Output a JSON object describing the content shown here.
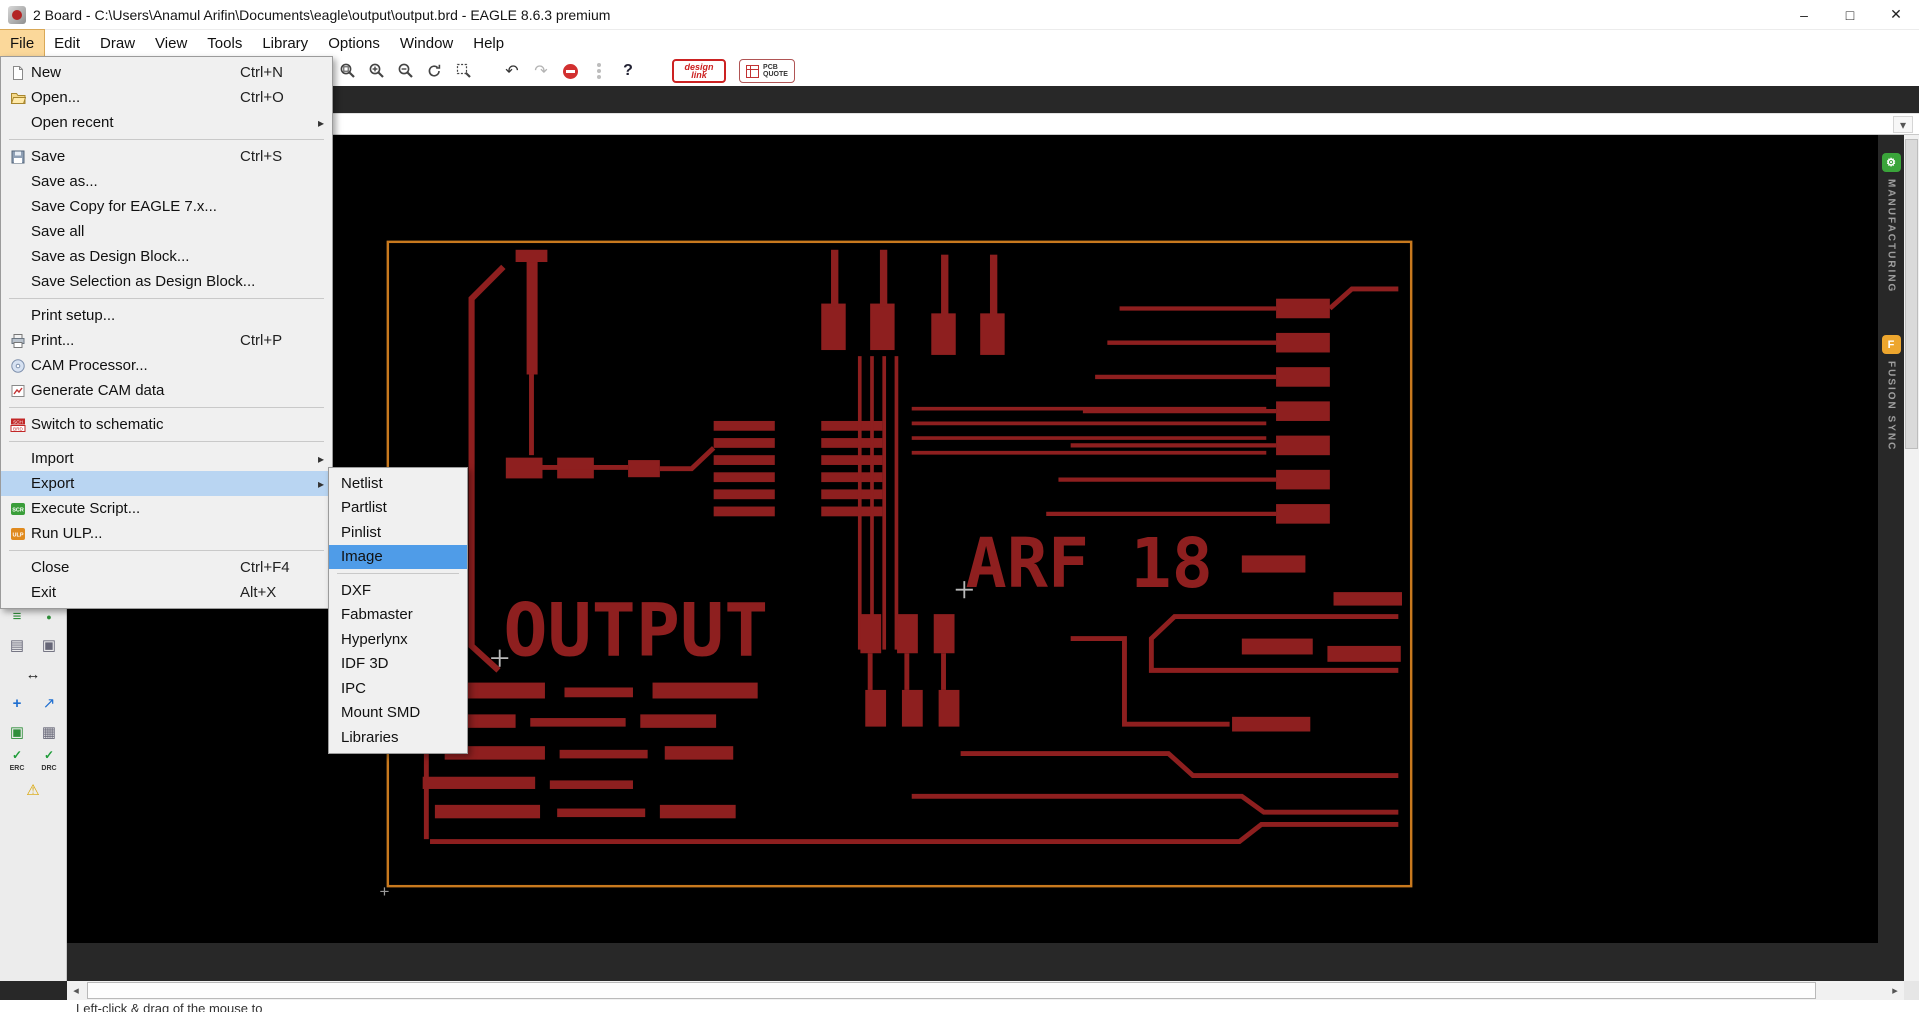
{
  "window": {
    "title": "2 Board - C:\\Users\\Anamul Arifin\\Documents\\eagle\\output\\output.brd - EAGLE 8.6.3 premium",
    "controls": {
      "minimize": "–",
      "maximize": "□",
      "close": "✕"
    }
  },
  "menubar": {
    "items": [
      {
        "label": "File"
      },
      {
        "label": "Edit"
      },
      {
        "label": "Draw"
      },
      {
        "label": "View"
      },
      {
        "label": "Tools"
      },
      {
        "label": "Library"
      },
      {
        "label": "Options"
      },
      {
        "label": "Window"
      },
      {
        "label": "Help"
      }
    ],
    "active": "File"
  },
  "toolbar": {
    "glyphs": {
      "undo": "↶",
      "redo": "↷",
      "help": "?"
    },
    "icons": [
      "zoom-fit",
      "zoom-in",
      "zoom-out",
      "zoom-redraw",
      "zoom-select",
      "undo",
      "redo",
      "stop",
      "signal-lights",
      "help"
    ],
    "design_link": {
      "line1": "design",
      "line2": "link"
    },
    "pcb_quote": {
      "line1": "PCB",
      "line2": "QUOTE"
    }
  },
  "file_menu": {
    "items": [
      {
        "label": "New",
        "shortcut": "Ctrl+N"
      },
      {
        "label": "Open...",
        "shortcut": "Ctrl+O"
      },
      {
        "label": "Open recent",
        "submenu": true
      },
      {
        "label": "Save",
        "shortcut": "Ctrl+S"
      },
      {
        "label": "Save as..."
      },
      {
        "label": "Save Copy for EAGLE 7.x..."
      },
      {
        "label": "Save all"
      },
      {
        "label": "Save as Design Block..."
      },
      {
        "label": "Save Selection as Design Block..."
      },
      {
        "label": "Print setup..."
      },
      {
        "label": "Print...",
        "shortcut": "Ctrl+P"
      },
      {
        "label": "CAM Processor..."
      },
      {
        "label": "Generate CAM data"
      },
      {
        "label": "Switch to schematic"
      },
      {
        "label": "Import",
        "submenu": true
      },
      {
        "label": "Export",
        "submenu": true,
        "highlighted": true
      },
      {
        "label": "Execute Script..."
      },
      {
        "label": "Run ULP..."
      },
      {
        "label": "Close",
        "shortcut": "Ctrl+F4"
      },
      {
        "label": "Exit",
        "shortcut": "Alt+X"
      }
    ]
  },
  "export_submenu": {
    "items": [
      {
        "label": "Netlist"
      },
      {
        "label": "Partlist"
      },
      {
        "label": "Pinlist"
      },
      {
        "label": "Image",
        "selected": true
      },
      {
        "label": "DXF"
      },
      {
        "label": "Fabmaster"
      },
      {
        "label": "Hyperlynx"
      },
      {
        "label": "IDF 3D"
      },
      {
        "label": "IPC"
      },
      {
        "label": "Mount SMD"
      },
      {
        "label": "Libraries"
      }
    ]
  },
  "side_tabs": [
    {
      "label": "MANUFACTURING",
      "icon_color": "#3aa43a"
    },
    {
      "label": "FUSION SYNC",
      "icon_color": "#eda62e"
    }
  ],
  "board": {
    "texts": {
      "name": "OUTPUT",
      "label": "ARF 18"
    },
    "colors": {
      "copper": "#8e1f1f",
      "outline": "#c8791e",
      "background": "#000000"
    }
  },
  "dock": {
    "erc_label": "ERC",
    "drc_label": "DRC",
    "check_glyph": "✓",
    "warning_glyph": "⚠",
    "icons": {
      "layers": "≡",
      "pin": "●",
      "sheet": "▤",
      "tag": "▣",
      "mirror": "↔",
      "move": "+",
      "route": "↗",
      "fill": "▣",
      "grid": "▦"
    }
  },
  "status": {
    "hint": "Left-click & drag of the mouse to"
  }
}
